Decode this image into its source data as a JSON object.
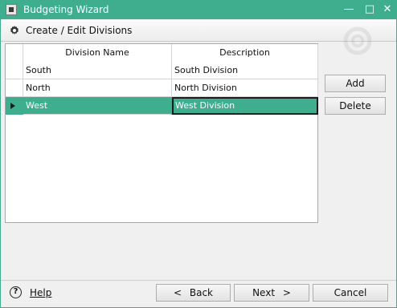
{
  "window": {
    "title": "Budgeting Wizard",
    "minimize_glyph": "—",
    "maximize_glyph": "□",
    "close_glyph": "✕",
    "accent": "#3fae8f"
  },
  "header": {
    "title": "Create / Edit Divisions",
    "icon": "gear-icon"
  },
  "grid": {
    "columns": [
      "Division Name",
      "Description"
    ],
    "rows": [
      {
        "name": "South",
        "description": "South Division"
      },
      {
        "name": "North",
        "description": "North Division"
      },
      {
        "name": "West",
        "description": "West Division"
      }
    ],
    "selected_row": 2
  },
  "side_buttons": {
    "add": "Add",
    "delete": "Delete"
  },
  "footer": {
    "help_icon_glyph": "?",
    "help": "Help",
    "back": "Back",
    "back_glyph": "<",
    "next": "Next",
    "next_glyph": ">",
    "cancel": "Cancel"
  }
}
